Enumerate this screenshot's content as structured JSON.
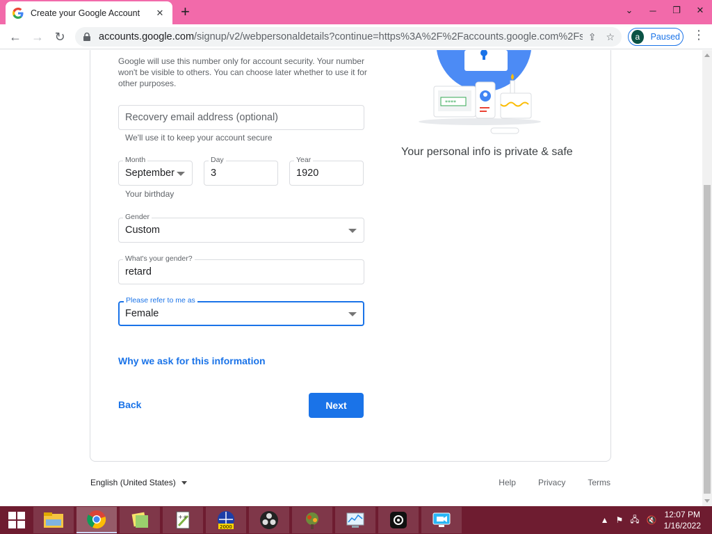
{
  "browser": {
    "tab_title": "Create your Google Account",
    "tab_close": "✕",
    "new_tab": "+",
    "url_host": "accounts.google.com",
    "url_path": "/signup/v2/webpersonaldetails?continue=https%3A%2F%2Faccounts.google.com%2Fsi...",
    "profile_initial": "a",
    "profile_status": "Paused",
    "accent": "#1a73e8",
    "titlebar_color": "#f26aaa"
  },
  "form": {
    "phone_helper": "Google will use this number only for account security. Your number won't be visible to others. You can choose later whether to use it for other purposes.",
    "recovery_email_placeholder": "Recovery email address (optional)",
    "recovery_email_hint": "We'll use it to keep your account secure",
    "month_label": "Month",
    "month_value": "September",
    "day_label": "Day",
    "day_value": "3",
    "year_label": "Year",
    "year_value": "1920",
    "birthday_hint": "Your birthday",
    "gender_label": "Gender",
    "gender_value": "Custom",
    "custom_gender_label": "What's your gender?",
    "custom_gender_value": "retard",
    "pronoun_label": "Please refer to me as",
    "pronoun_value": "Female",
    "why_link": "Why we ask for this information",
    "back_label": "Back",
    "next_label": "Next"
  },
  "side": {
    "private_text": "Your personal info is private & safe"
  },
  "footer": {
    "language": "English (United States)",
    "links": [
      "Help",
      "Privacy",
      "Terms"
    ]
  },
  "taskbar": {
    "time": "12:07 PM",
    "date": "1/16/2022",
    "color": "#6e1c30"
  }
}
